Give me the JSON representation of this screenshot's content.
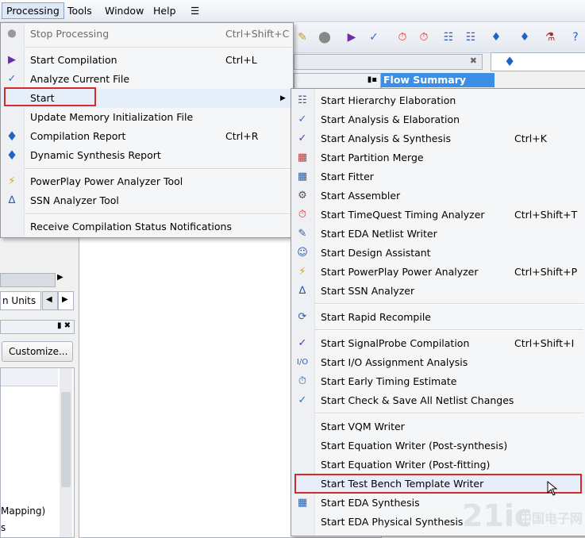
{
  "menubar": {
    "items": [
      {
        "label": "Processing"
      },
      {
        "label": "Tools"
      },
      {
        "label": "Window"
      },
      {
        "label": "Help"
      }
    ]
  },
  "background": {
    "flow_summary_title": "Flow Summary",
    "units_tab": "n Units",
    "customize_button": "Customize...",
    "list_items": [
      "Mapping)",
      "s"
    ]
  },
  "processing_menu": {
    "stop": {
      "label": "Stop Processing",
      "shortcut": "Ctrl+Shift+C"
    },
    "start_compilation": {
      "label": "Start Compilation",
      "shortcut": "Ctrl+L"
    },
    "analyze_current": {
      "label": "Analyze Current File"
    },
    "start": {
      "label": "Start"
    },
    "update_memory": {
      "label": "Update Memory Initialization File"
    },
    "compilation_report": {
      "label": "Compilation Report",
      "shortcut": "Ctrl+R"
    },
    "dynamic_synthesis": {
      "label": "Dynamic Synthesis Report"
    },
    "powerplay": {
      "label": "PowerPlay Power Analyzer Tool"
    },
    "ssn": {
      "label": "SSN Analyzer Tool"
    },
    "receive_notifications": {
      "label": "Receive Compilation Status Notifications"
    }
  },
  "start_submenu": {
    "items": [
      {
        "label": "Start Hierarchy Elaboration",
        "shortcut": ""
      },
      {
        "label": "Start Analysis & Elaboration",
        "shortcut": ""
      },
      {
        "label": "Start Analysis & Synthesis",
        "shortcut": "Ctrl+K"
      },
      {
        "label": "Start Partition Merge",
        "shortcut": ""
      },
      {
        "label": "Start Fitter",
        "shortcut": ""
      },
      {
        "label": "Start Assembler",
        "shortcut": ""
      },
      {
        "label": "Start TimeQuest Timing Analyzer",
        "shortcut": "Ctrl+Shift+T"
      },
      {
        "label": "Start EDA Netlist Writer",
        "shortcut": ""
      },
      {
        "label": "Start Design Assistant",
        "shortcut": ""
      },
      {
        "label": "Start PowerPlay Power Analyzer",
        "shortcut": "Ctrl+Shift+P"
      },
      {
        "label": "Start SSN Analyzer",
        "shortcut": ""
      },
      {
        "label": "Start Rapid Recompile",
        "shortcut": ""
      },
      {
        "label": "Start SignalProbe Compilation",
        "shortcut": "Ctrl+Shift+I"
      },
      {
        "label": "Start I/O Assignment Analysis",
        "shortcut": ""
      },
      {
        "label": "Start Early Timing Estimate",
        "shortcut": ""
      },
      {
        "label": "Start Check & Save All Netlist Changes",
        "shortcut": ""
      },
      {
        "label": "Start VQM Writer",
        "shortcut": ""
      },
      {
        "label": "Start Equation Writer (Post-synthesis)",
        "shortcut": ""
      },
      {
        "label": "Start Equation Writer (Post-fitting)",
        "shortcut": ""
      },
      {
        "label": "Start Test Bench Template Writer",
        "shortcut": ""
      },
      {
        "label": "Start EDA Synthesis",
        "shortcut": ""
      },
      {
        "label": "Start EDA Physical Synthesis",
        "shortcut": ""
      }
    ]
  },
  "colors": {
    "highlight_border": "#d32a2a",
    "flow_title_bg": "#3b8fe5",
    "menu_bg": "#f5f6f7"
  },
  "watermark": {
    "text": "21ic",
    "cn": "中国电子网"
  }
}
